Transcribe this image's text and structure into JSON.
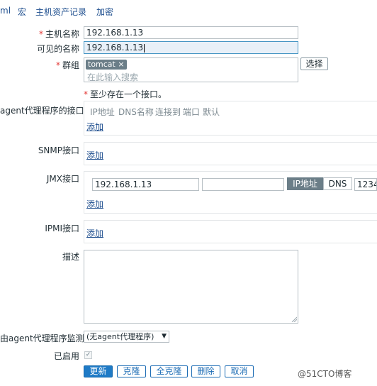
{
  "tabs": [
    {
      "label": "ml"
    },
    {
      "label": "宏"
    },
    {
      "label": "主机资产记录"
    },
    {
      "label": "加密"
    }
  ],
  "form": {
    "hostname": {
      "label": "主机名称",
      "value": "192.168.1.13"
    },
    "visible_name": {
      "label": "可见的名称",
      "value": "192.168.1.13"
    },
    "groups": {
      "label": "群组",
      "tag": "tomcat",
      "tag_remove": "×",
      "placeholder": "在此输入搜索",
      "select_button": "选择"
    },
    "required_mark": "*",
    "interface_note": "至少存在一个接口。"
  },
  "interfaces": {
    "agent": {
      "label": "agent代理程序的接口",
      "add": "添加"
    },
    "headers": [
      "IP地址",
      "DNS名称",
      "连接到",
      "端口",
      "默认"
    ],
    "snmp": {
      "label": "SNMP接口",
      "add": "添加"
    },
    "jmx": {
      "label": "JMX接口",
      "ip": "192.168.1.13",
      "dns": "",
      "connect_ip": "IP地址",
      "connect_dns": "DNS",
      "port": "1234",
      "add": "添加"
    },
    "ipmi": {
      "label": "IPMI接口",
      "add": "添加"
    }
  },
  "description": {
    "label": "描述",
    "value": ""
  },
  "monitored_by": {
    "label": "由agent代理程序监测",
    "selected": "(无agent代理程序)",
    "arrow": "▼"
  },
  "enabled": {
    "label": "已启用",
    "checked": true,
    "check_glyph": "✓"
  },
  "actions": {
    "update": "更新",
    "clone": "克隆",
    "full_clone": "全克隆",
    "delete": "删除",
    "cancel": "取消"
  },
  "watermark": "@51CTO博客",
  "colors": {
    "link": "#1f4f8f",
    "primary_button": "#1e7ac6",
    "required": "#e33734",
    "tag_bg": "#6b7e88"
  }
}
